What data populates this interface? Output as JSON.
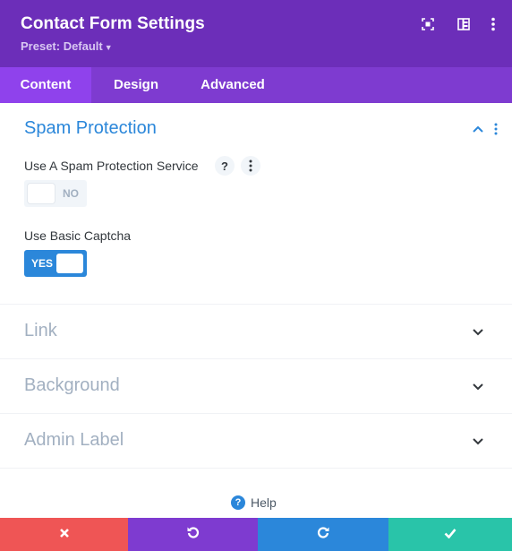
{
  "header": {
    "title": "Contact Form Settings",
    "preset_label": "Preset: Default",
    "icons": [
      "expand-icon",
      "split-view-icon",
      "more-vertical-icon"
    ]
  },
  "tabs": [
    {
      "label": "Content",
      "active": true
    },
    {
      "label": "Design",
      "active": false
    },
    {
      "label": "Advanced",
      "active": false
    }
  ],
  "sections": {
    "spam": {
      "title": "Spam Protection",
      "expanded": true,
      "fields": [
        {
          "label": "Use A Spam Protection Service",
          "toggle_text": "NO",
          "value": false
        },
        {
          "label": "Use Basic Captcha",
          "toggle_text": "YES",
          "value": true
        }
      ]
    },
    "link": {
      "title": "Link",
      "expanded": false
    },
    "background": {
      "title": "Background",
      "expanded": false
    },
    "admin_label": {
      "title": "Admin Label",
      "expanded": false
    }
  },
  "help": {
    "icon_text": "?",
    "label": "Help"
  },
  "footer": {
    "buttons": [
      {
        "name": "cancel",
        "icon": "close-icon",
        "color": "#ef5555"
      },
      {
        "name": "undo",
        "icon": "undo-icon",
        "color": "#7e3bd0"
      },
      {
        "name": "redo",
        "icon": "redo-icon",
        "color": "#2b87da"
      },
      {
        "name": "save",
        "icon": "check-icon",
        "color": "#29c4a9"
      }
    ]
  },
  "colors": {
    "header_bg": "#6c2eb9",
    "tabs_bg": "#7e3bd0",
    "active_tab_bg": "#8f42ec",
    "accent_blue": "#2b87da",
    "muted_section_title": "#a2b0c1"
  }
}
